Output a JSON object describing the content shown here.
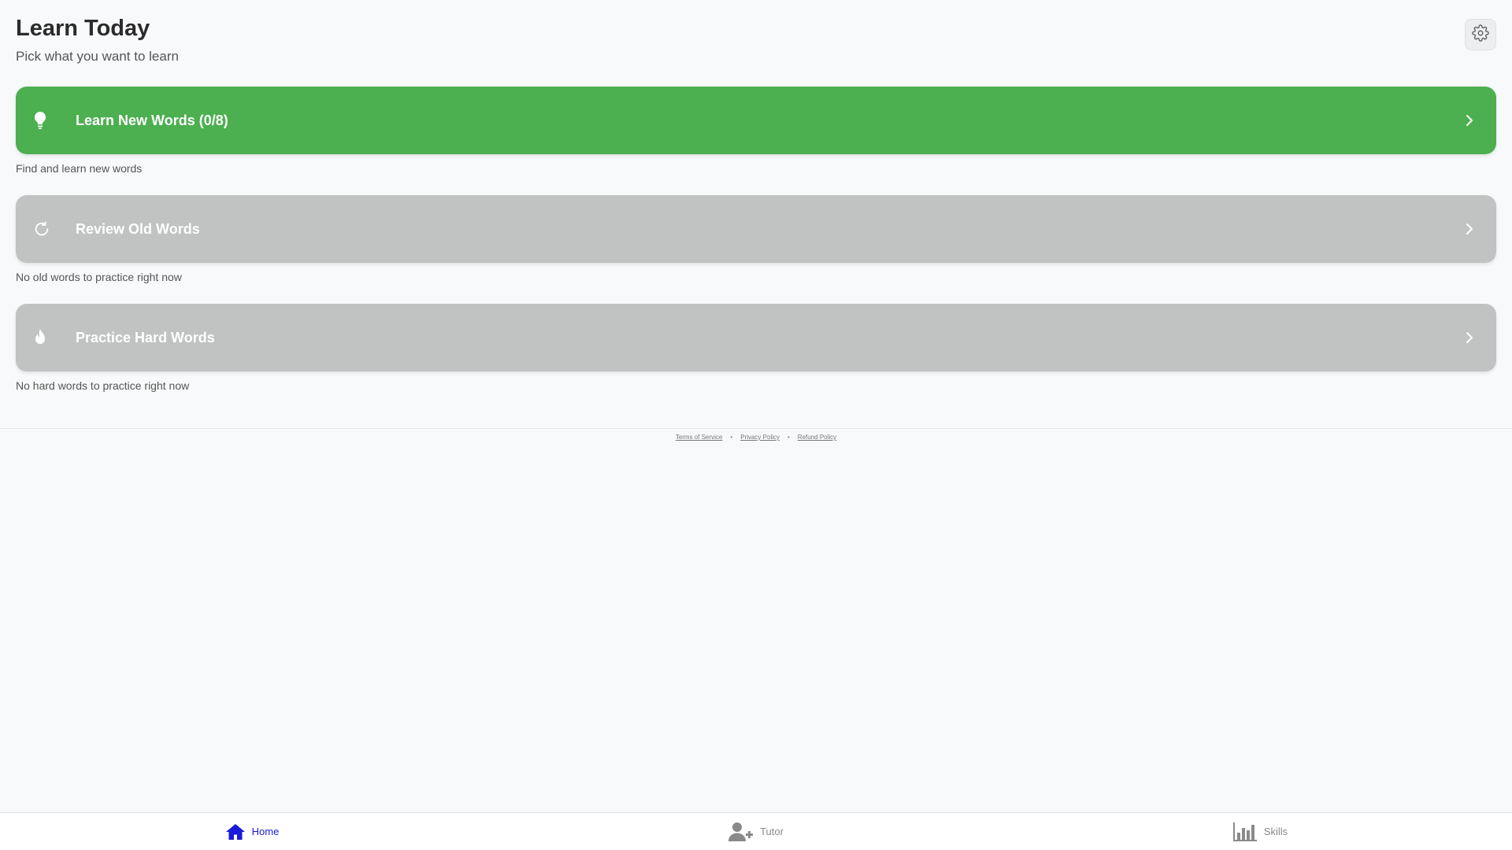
{
  "header": {
    "title": "Learn Today",
    "subtitle": "Pick what you want to learn",
    "settings_icon": "gear-icon"
  },
  "cards": [
    {
      "label": "Learn New Words (0/8)",
      "description": "Find and learn new words",
      "icon": "lightbulb-icon",
      "state": "active",
      "color": "#4caf50"
    },
    {
      "label": "Review Old Words",
      "description": "No old words to practice right now",
      "icon": "refresh-icon",
      "state": "disabled",
      "color": "#c1c2c2"
    },
    {
      "label": "Practice Hard Words",
      "description": "No hard words to practice right now",
      "icon": "flame-icon",
      "state": "disabled",
      "color": "#c1c2c2"
    }
  ],
  "footer": {
    "links": [
      "Terms of Service",
      "Privacy Policy",
      "Refund Policy"
    ]
  },
  "bottom_nav": {
    "items": [
      {
        "label": "Home",
        "icon": "home-icon",
        "active": true
      },
      {
        "label": "Tutor",
        "icon": "user-plus-icon",
        "active": false
      },
      {
        "label": "Skills",
        "icon": "bar-chart-icon",
        "active": false
      }
    ],
    "active_color": "#1a1adb",
    "inactive_color": "#8a8a8a"
  }
}
